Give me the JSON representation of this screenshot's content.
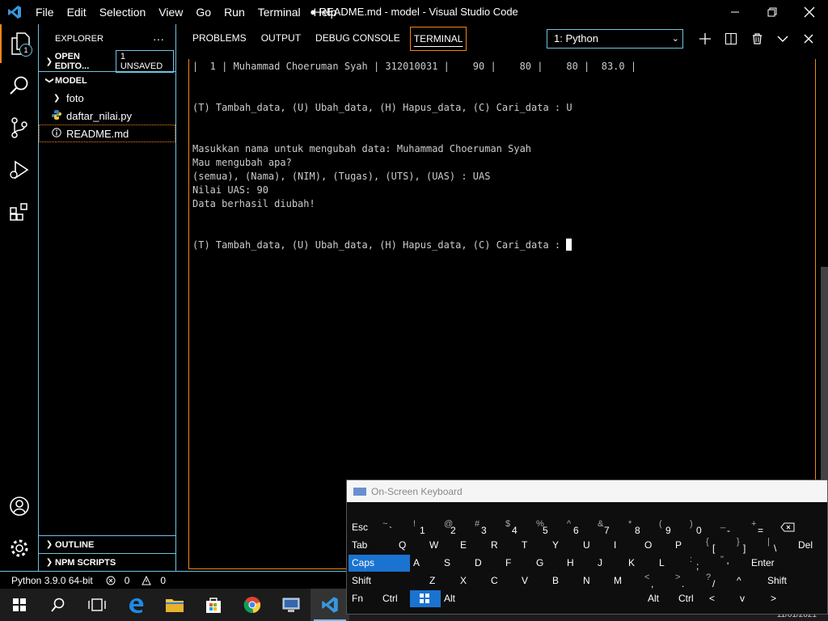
{
  "window": {
    "title": "● README.md - model - Visual Studio Code",
    "menu": [
      "File",
      "Edit",
      "Selection",
      "View",
      "Go",
      "Run",
      "Terminal",
      "Help"
    ]
  },
  "activity_bar": {
    "explorer_badge": "1"
  },
  "sidebar": {
    "title": "EXPLORER",
    "more": "···",
    "open_editors": "OPEN EDITO...",
    "unsaved": "1 UNSAVED",
    "folder": "MODEL",
    "items": [
      {
        "label": "foto",
        "type": "folder"
      },
      {
        "label": "daftar_nilai.py",
        "type": "python"
      },
      {
        "label": "README.md",
        "type": "info"
      }
    ],
    "outline": "OUTLINE",
    "npm_scripts": "NPM SCRIPTS"
  },
  "panel": {
    "tabs": [
      "PROBLEMS",
      "OUTPUT",
      "DEBUG CONSOLE",
      "TERMINAL"
    ],
    "active_tab": "TERMINAL",
    "terminal_select": "1: Python"
  },
  "terminal": {
    "lines": [
      "|  1 | Muhammad Choeruman Syah | 312010031 |    90 |    80 |    80 |  83.0 |",
      "",
      "",
      "(T) Tambah_data, (U) Ubah_data, (H) Hapus_data, (C) Cari_data : U",
      "",
      "",
      "Masukkan nama untuk mengubah data: Muhammad Choeruman Syah",
      "Mau mengubah apa?",
      "(semua), (Nama), (NIM), (Tugas), (UTS), (UAS) : UAS",
      "Nilai UAS: 90",
      "Data berhasil diubah!",
      "",
      "",
      "(T) Tambah_data, (U) Ubah_data, (H) Hapus_data, (C) Cari_data : "
    ]
  },
  "statusbar": {
    "interpreter": "Python 3.9.0 64-bit",
    "errors": "0",
    "warnings": "0"
  },
  "taskbar": {
    "clock": "11/01/2021"
  },
  "osk": {
    "title": "On-Screen Keyboard",
    "row1": [
      "Esc",
      "~ `",
      "! 1",
      "@ 2",
      "# 3",
      "$ 4",
      "% 5",
      "^ 6",
      "& 7",
      "* 8",
      "( 9",
      ") 0",
      "_ -",
      "+ ="
    ],
    "row2": [
      "Tab",
      "Q",
      "W",
      "E",
      "R",
      "T",
      "Y",
      "U",
      "I",
      "O",
      "P",
      "{ [",
      "} ]",
      "| \\",
      "Del"
    ],
    "row3": [
      "Caps",
      "A",
      "S",
      "D",
      "F",
      "G",
      "H",
      "J",
      "K",
      "L",
      ": ;",
      "\" '",
      "Enter"
    ],
    "row4": [
      "Shift",
      "Z",
      "X",
      "C",
      "V",
      "B",
      "N",
      "M",
      "< ,",
      "> .",
      "? /",
      "^",
      "Shift"
    ],
    "row5": [
      "Fn",
      "Ctrl",
      "Win",
      "Alt",
      "Alt",
      "Ctrl",
      "<",
      "v",
      ">"
    ]
  }
}
